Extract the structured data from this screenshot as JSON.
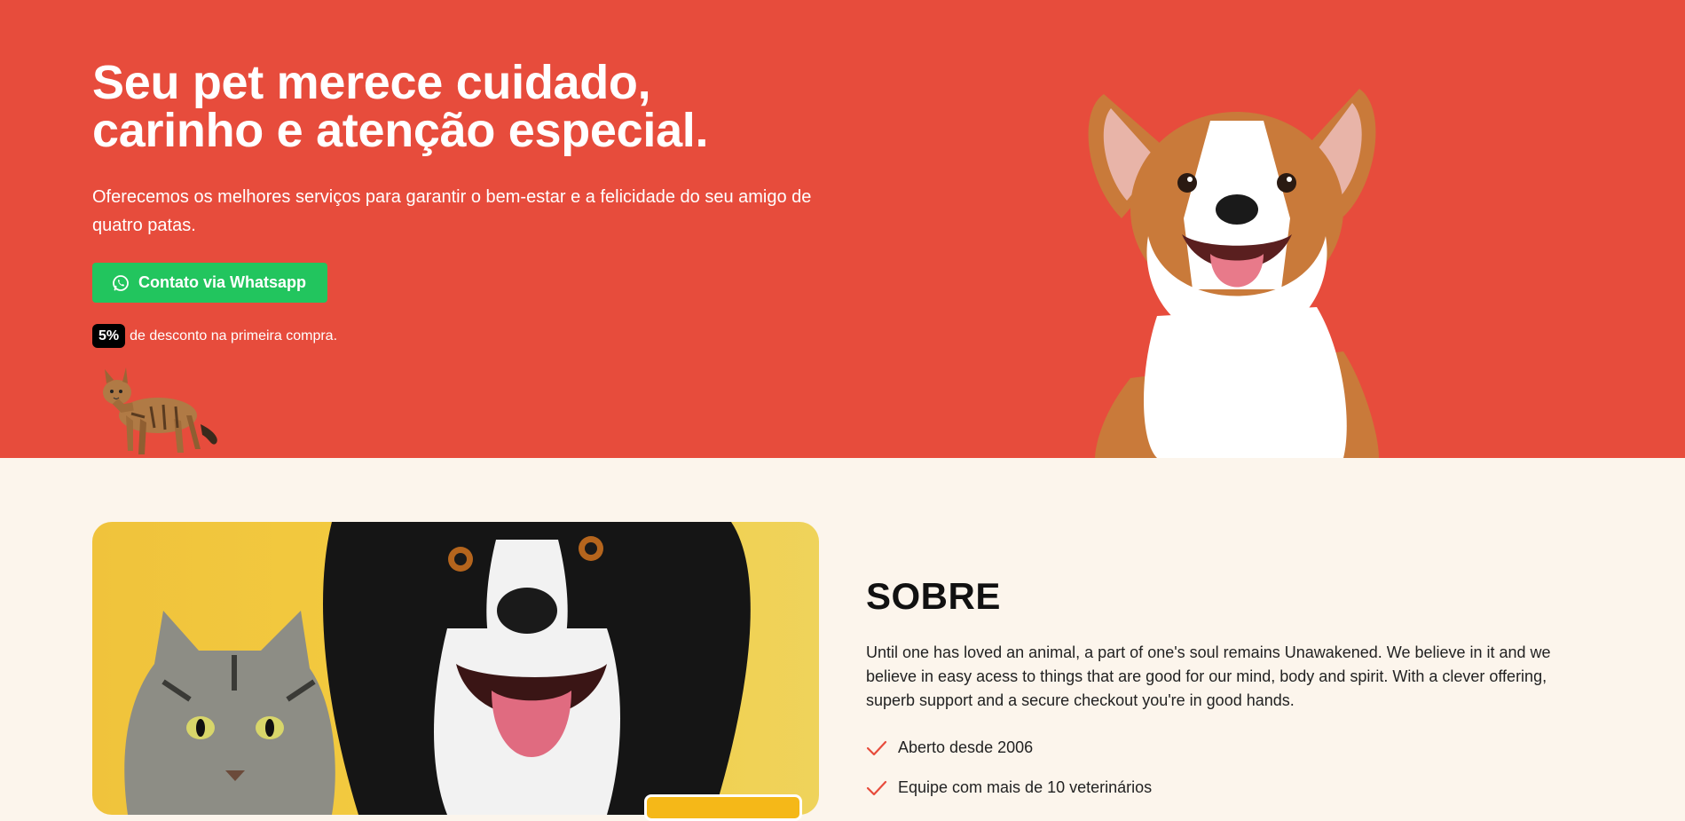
{
  "hero": {
    "title_line1": "Seu pet merece cuidado,",
    "title_line2": "carinho e atenção especial.",
    "subtitle": "Oferecemos os melhores serviços para garantir o bem-estar e a felicidade do seu amigo de quatro patas.",
    "cta_label": "Contato via Whatsapp",
    "cta_icon": "whatsapp-icon",
    "discount_badge": "5%",
    "discount_text": "de desconto na primeira compra.",
    "background_color": "#e74c3c",
    "cta_color": "#22c55e"
  },
  "about": {
    "title": "SOBRE",
    "text": "Until one has loved an animal, a part of one's soul remains Unawakened. We believe in it and we believe in easy acess to things that are good for our mind, body and spirit. With a clever offering, superb support and a secure checkout you're in good hands.",
    "features": [
      "Aberto desde 2006",
      "Equipe com mais de 10 veterinários"
    ],
    "check_icon": "check-icon",
    "check_color": "#e74c3c",
    "background_color": "#fcf5ec"
  }
}
